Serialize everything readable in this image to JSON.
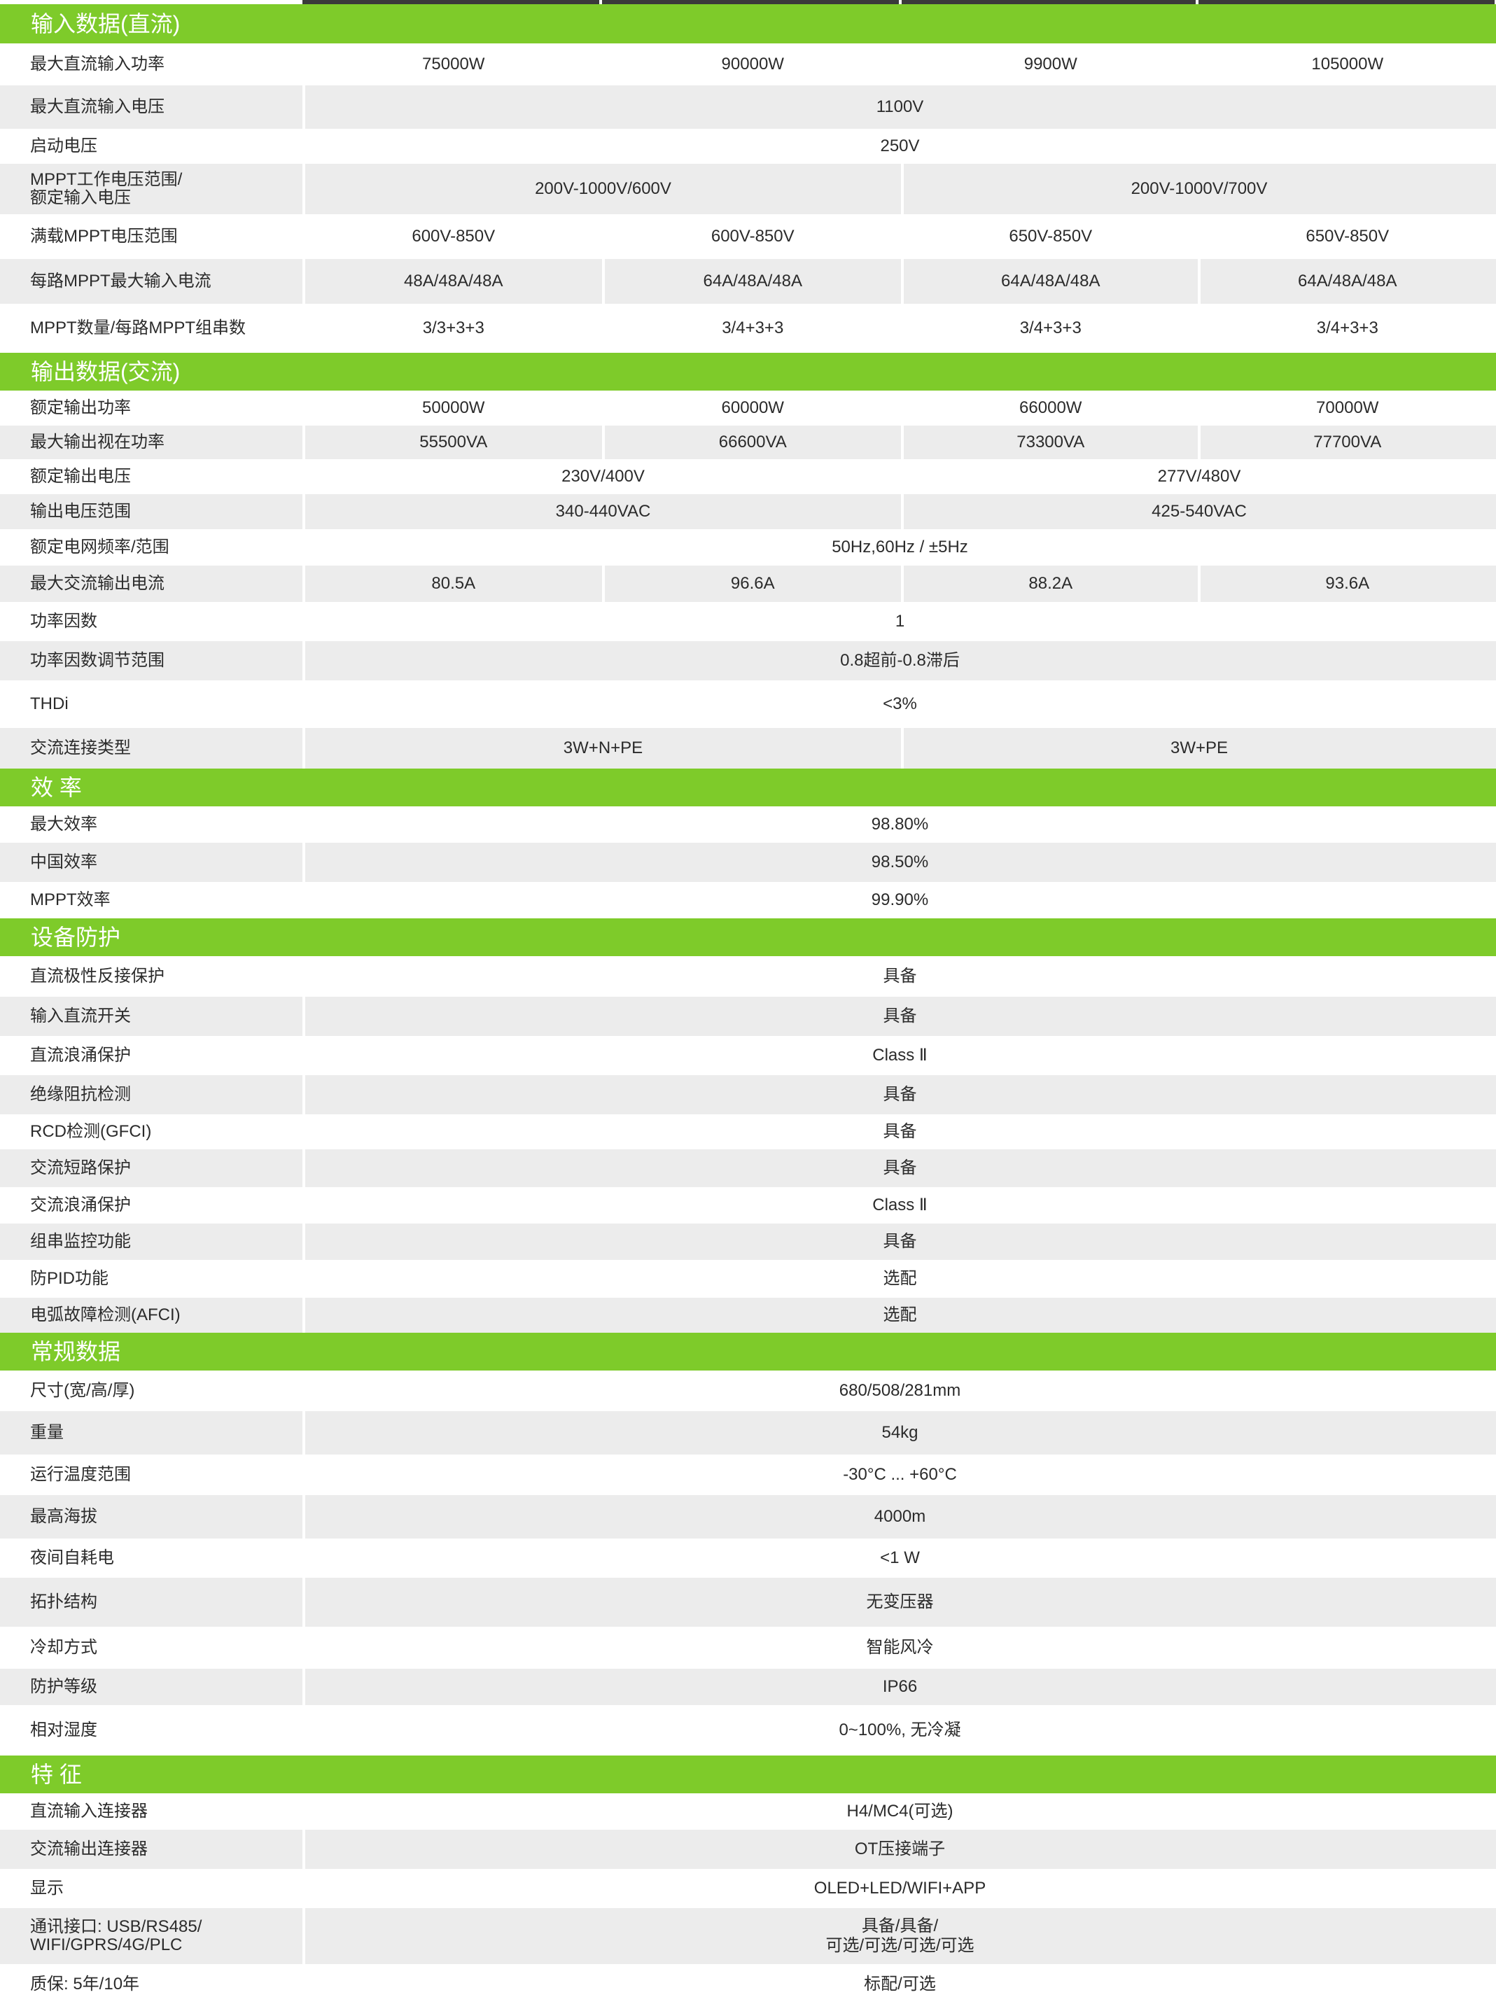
{
  "sections": [
    {
      "title": "输入数据(直流)",
      "rows": [
        {
          "label": "最大直流输入功率",
          "cells": [
            {
              "span": 1,
              "text": "75000W"
            },
            {
              "span": 1,
              "text": "90000W"
            },
            {
              "span": 1,
              "text": "9900W"
            },
            {
              "span": 1,
              "text": "105000W"
            }
          ]
        },
        {
          "label": "最大直流输入电压",
          "cells": [
            {
              "span": 4,
              "text": "1100V"
            }
          ]
        },
        {
          "label": "启动电压",
          "cells": [
            {
              "span": 4,
              "text": "250V"
            }
          ]
        },
        {
          "label": "MPPT工作电压范围/\n额定输入电压",
          "cells": [
            {
              "span": 2,
              "text": "200V-1000V/600V"
            },
            {
              "span": 2,
              "text": "200V-1000V/700V"
            }
          ]
        },
        {
          "label": "满载MPPT电压范围",
          "cells": [
            {
              "span": 1,
              "text": "600V-850V"
            },
            {
              "span": 1,
              "text": "600V-850V"
            },
            {
              "span": 1,
              "text": "650V-850V"
            },
            {
              "span": 1,
              "text": "650V-850V"
            }
          ]
        },
        {
          "label": "每路MPPT最大输入电流",
          "cells": [
            {
              "span": 1,
              "text": "48A/48A/48A"
            },
            {
              "span": 1,
              "text": "64A/48A/48A"
            },
            {
              "span": 1,
              "text": "64A/48A/48A"
            },
            {
              "span": 1,
              "text": "64A/48A/48A"
            }
          ]
        },
        {
          "label": "MPPT数量/每路MPPT组串数",
          "cells": [
            {
              "span": 1,
              "text": "3/3+3+3"
            },
            {
              "span": 1,
              "text": "3/4+3+3"
            },
            {
              "span": 1,
              "text": "3/4+3+3"
            },
            {
              "span": 1,
              "text": "3/4+3+3"
            }
          ]
        }
      ]
    },
    {
      "title": "输出数据(交流)",
      "rows": [
        {
          "label": "额定输出功率",
          "cells": [
            {
              "span": 1,
              "text": "50000W"
            },
            {
              "span": 1,
              "text": "60000W"
            },
            {
              "span": 1,
              "text": "66000W"
            },
            {
              "span": 1,
              "text": "70000W"
            }
          ]
        },
        {
          "label": "最大输出视在功率",
          "cells": [
            {
              "span": 1,
              "text": "55500VA"
            },
            {
              "span": 1,
              "text": "66600VA"
            },
            {
              "span": 1,
              "text": "73300VA"
            },
            {
              "span": 1,
              "text": "77700VA"
            }
          ]
        },
        {
          "label": "额定输出电压",
          "cells": [
            {
              "span": 2,
              "text": "230V/400V"
            },
            {
              "span": 2,
              "text": "277V/480V"
            }
          ]
        },
        {
          "label": "输出电压范围",
          "cells": [
            {
              "span": 2,
              "text": "340-440VAC"
            },
            {
              "span": 2,
              "text": "425-540VAC"
            }
          ]
        },
        {
          "label": "额定电网频率/范围",
          "cells": [
            {
              "span": 4,
              "text": "50Hz,60Hz / ±5Hz"
            }
          ]
        },
        {
          "label": "最大交流输出电流",
          "cells": [
            {
              "span": 1,
              "text": "80.5A"
            },
            {
              "span": 1,
              "text": "96.6A"
            },
            {
              "span": 1,
              "text": "88.2A"
            },
            {
              "span": 1,
              "text": "93.6A"
            }
          ]
        },
        {
          "label": "功率因数",
          "cells": [
            {
              "span": 4,
              "text": "1"
            }
          ]
        },
        {
          "label": "功率因数调节范围",
          "cells": [
            {
              "span": 4,
              "text": "0.8超前-0.8滞后"
            }
          ]
        },
        {
          "label": "THDi",
          "cells": [
            {
              "span": 4,
              "text": "<3%"
            }
          ]
        },
        {
          "label": "交流连接类型",
          "cells": [
            {
              "span": 2,
              "text": "3W+N+PE"
            },
            {
              "span": 2,
              "text": "3W+PE"
            }
          ]
        }
      ]
    },
    {
      "title": "效  率",
      "rows": [
        {
          "label": "最大效率",
          "cells": [
            {
              "span": 4,
              "text": "98.80%"
            }
          ]
        },
        {
          "label": "中国效率",
          "cells": [
            {
              "span": 4,
              "text": "98.50%"
            }
          ]
        },
        {
          "label": "MPPT效率",
          "cells": [
            {
              "span": 4,
              "text": "99.90%"
            }
          ]
        }
      ]
    },
    {
      "title": "设备防护",
      "rows": [
        {
          "label": "直流极性反接保护",
          "cells": [
            {
              "span": 4,
              "text": "具备"
            }
          ]
        },
        {
          "label": "输入直流开关",
          "cells": [
            {
              "span": 4,
              "text": "具备"
            }
          ]
        },
        {
          "label": "直流浪涌保护",
          "cells": [
            {
              "span": 4,
              "text": "Class Ⅱ"
            }
          ]
        },
        {
          "label": "绝缘阻抗检测",
          "cells": [
            {
              "span": 4,
              "text": "具备"
            }
          ]
        },
        {
          "label": "RCD检测(GFCI)",
          "cells": [
            {
              "span": 4,
              "text": "具备"
            }
          ]
        },
        {
          "label": "交流短路保护",
          "cells": [
            {
              "span": 4,
              "text": "具备"
            }
          ]
        },
        {
          "label": "交流浪涌保护",
          "cells": [
            {
              "span": 4,
              "text": "Class Ⅱ"
            }
          ]
        },
        {
          "label": "组串监控功能",
          "cells": [
            {
              "span": 4,
              "text": "具备"
            }
          ]
        },
        {
          "label": "防PID功能",
          "cells": [
            {
              "span": 4,
              "text": "选配"
            }
          ]
        },
        {
          "label": "电弧故障检测(AFCI)",
          "cells": [
            {
              "span": 4,
              "text": "选配"
            }
          ]
        }
      ]
    },
    {
      "title": "常规数据",
      "rows": [
        {
          "label": "尺寸(宽/高/厚)",
          "cells": [
            {
              "span": 4,
              "text": "680/508/281mm"
            }
          ]
        },
        {
          "label": "重量",
          "cells": [
            {
              "span": 4,
              "text": "54kg"
            }
          ]
        },
        {
          "label": "运行温度范围",
          "cells": [
            {
              "span": 4,
              "text": "-30°C ... +60°C"
            }
          ]
        },
        {
          "label": "最高海拔",
          "cells": [
            {
              "span": 4,
              "text": "4000m"
            }
          ]
        },
        {
          "label": "夜间自耗电",
          "cells": [
            {
              "span": 4,
              "text": "<1 W"
            }
          ]
        },
        {
          "label": "拓扑结构",
          "cells": [
            {
              "span": 4,
              "text": "无变压器"
            }
          ]
        },
        {
          "label": "冷却方式",
          "cells": [
            {
              "span": 4,
              "text": "智能风冷"
            }
          ]
        },
        {
          "label": "防护等级",
          "cells": [
            {
              "span": 4,
              "text": "IP66"
            }
          ]
        },
        {
          "label": "相对湿度",
          "cells": [
            {
              "span": 4,
              "text": "0~100%, 无冷凝"
            }
          ]
        }
      ]
    },
    {
      "title": "特  征",
      "rows": [
        {
          "label": "直流输入连接器",
          "cells": [
            {
              "span": 4,
              "text": "H4/MC4(可选)"
            }
          ]
        },
        {
          "label": "交流输出连接器",
          "cells": [
            {
              "span": 4,
              "text": "OT压接端子"
            }
          ]
        },
        {
          "label": "显示",
          "cells": [
            {
              "span": 4,
              "text": "OLED+LED/WIFI+APP"
            }
          ]
        },
        {
          "label": "通讯接口: USB/RS485/\nWIFI/GPRS/4G/PLC",
          "cells": [
            {
              "span": 4,
              "text": "具备/具备/\n可选/可选/可选/可选"
            }
          ]
        },
        {
          "label": "质保: 5年/10年",
          "cells": [
            {
              "span": 4,
              "text": "标配/可选"
            }
          ]
        }
      ]
    }
  ]
}
